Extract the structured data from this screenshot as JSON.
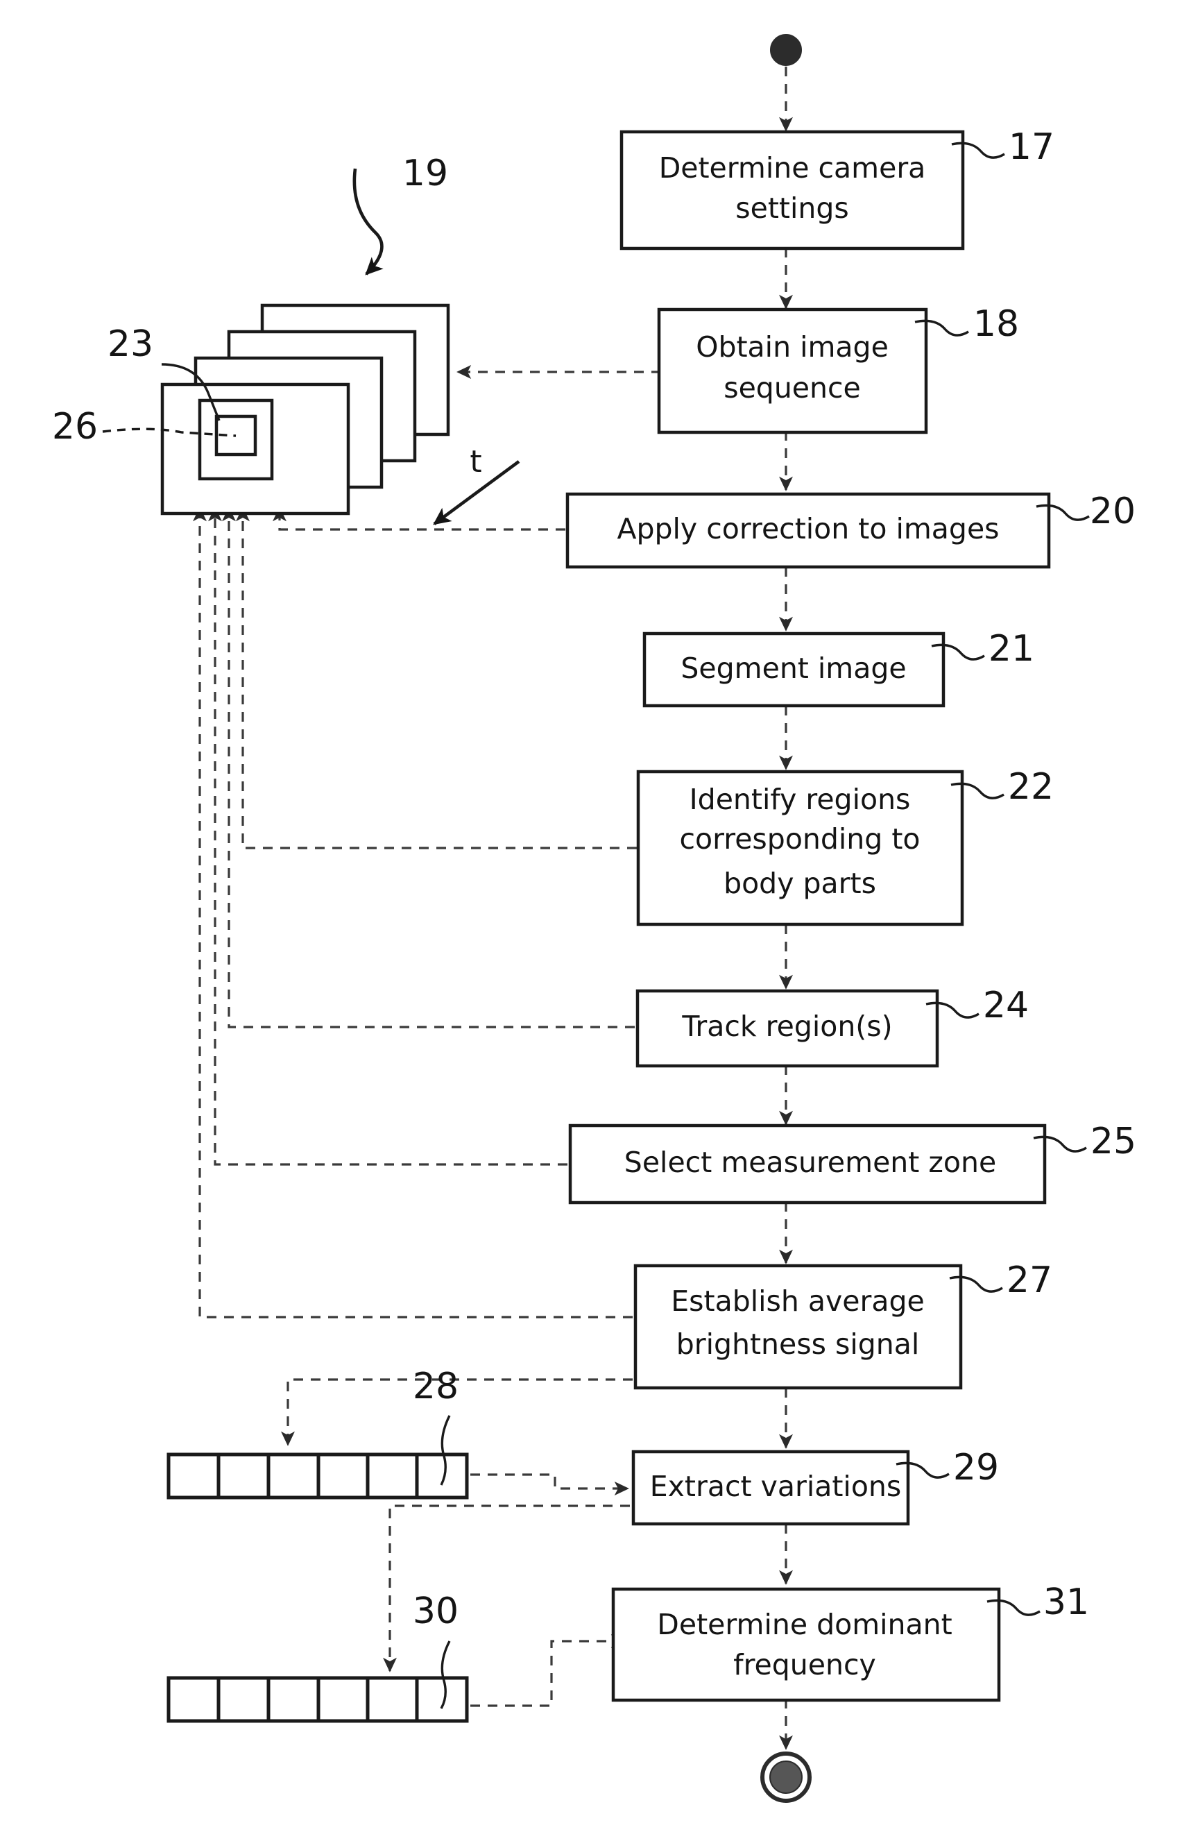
{
  "figure": {
    "type": "patent-flowchart",
    "title": "",
    "start_node": "filled-dot",
    "end_node": "double-circle"
  },
  "steps": [
    {
      "id": "17",
      "label": "Determine camera settings",
      "ref": "17"
    },
    {
      "id": "18",
      "label": "Obtain image sequence",
      "ref": "18"
    },
    {
      "id": "20",
      "label": "Apply correction to images",
      "ref": "20"
    },
    {
      "id": "21",
      "label": "Segment image",
      "ref": "21"
    },
    {
      "id": "22",
      "label": "Identify regions corresponding to body parts",
      "ref": "22"
    },
    {
      "id": "24",
      "label": "Track region(s)",
      "ref": "24"
    },
    {
      "id": "25",
      "label": "Select measurement zone",
      "ref": "25"
    },
    {
      "id": "27",
      "label": "Establish average brightness signal",
      "ref": "27"
    },
    {
      "id": "29",
      "label": "Extract variations",
      "ref": "29"
    },
    {
      "id": "31",
      "label": "Determine dominant frequency",
      "ref": "31"
    }
  ],
  "step_lines": {
    "s17": [
      "Determine camera",
      "settings"
    ],
    "s18": [
      "Obtain image",
      "sequence"
    ],
    "s20": [
      "Apply correction to images"
    ],
    "s21": [
      "Segment image"
    ],
    "s22": [
      "Identify regions",
      "corresponding to",
      "body parts"
    ],
    "s24": [
      "Track region(s)"
    ],
    "s25": [
      "Select measurement zone"
    ],
    "s27": [
      "Establish average",
      "brightness signal"
    ],
    "s29": [
      "Extract variations"
    ],
    "s31": [
      "Determine dominant",
      "frequency"
    ]
  },
  "artifacts": [
    {
      "ref": "19",
      "name": "image-sequence-stack",
      "frames": 4
    },
    {
      "ref": "23",
      "name": "body-part-region"
    },
    {
      "ref": "26",
      "name": "measurement-zone"
    },
    {
      "ref": "28",
      "name": "brightness-signal-strip",
      "cells": 6
    },
    {
      "ref": "30",
      "name": "variation-signal-strip",
      "cells": 6
    }
  ],
  "labels": {
    "n17": "17",
    "n18": "18",
    "n19": "19",
    "n20": "20",
    "n21": "21",
    "n22": "22",
    "n23": "23",
    "n24": "24",
    "n25": "25",
    "n26": "26",
    "n27": "27",
    "n28": "28",
    "n29": "29",
    "n30": "30",
    "n31": "31",
    "time_axis": "t"
  },
  "colors": {
    "ink": "#141414",
    "line": "#3a3a3a",
    "paper": "#ffffff"
  }
}
